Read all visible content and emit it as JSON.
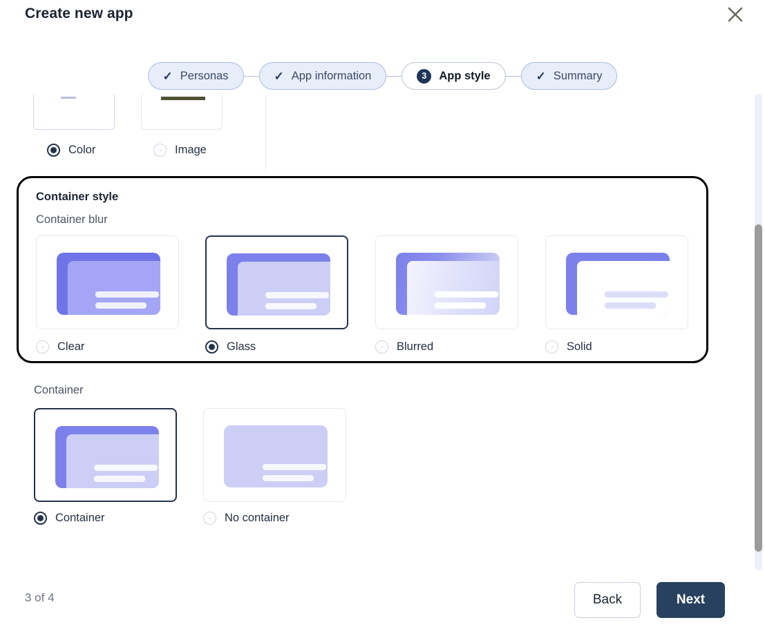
{
  "header": {
    "title": "Create new app",
    "close_icon": "close-icon"
  },
  "stepper": {
    "steps": [
      {
        "label": "Personas",
        "state": "done",
        "marker": "✓"
      },
      {
        "label": "App information",
        "state": "done",
        "marker": "✓"
      },
      {
        "label": "App style",
        "state": "active",
        "marker": "3"
      },
      {
        "label": "Summary",
        "state": "done",
        "marker": "✓"
      }
    ]
  },
  "background_type": {
    "options": [
      {
        "label": "Color",
        "selected": true
      },
      {
        "label": "Image",
        "selected": false
      }
    ]
  },
  "container_style": {
    "group_title": "Container style",
    "blur_label": "Container blur",
    "blur_options": [
      {
        "label": "Clear",
        "selected": false,
        "variant": "v-clear"
      },
      {
        "label": "Glass",
        "selected": true,
        "variant": "v-glass"
      },
      {
        "label": "Blurred",
        "selected": false,
        "variant": "v-blurred"
      },
      {
        "label": "Solid",
        "selected": false,
        "variant": "v-solid"
      }
    ],
    "container_label": "Container",
    "container_options": [
      {
        "label": "Container",
        "selected": true,
        "variant": "v-container"
      },
      {
        "label": "No container",
        "selected": false,
        "variant": "v-nocontainer"
      }
    ]
  },
  "footer": {
    "page_indicator": "3 of 4",
    "back_label": "Back",
    "next_label": "Next"
  },
  "colors": {
    "accent_navy": "#28415e",
    "step_done_bg": "#e8edfa",
    "step_done_border": "#a8bbe6",
    "thumb_blue": "#7b80ea",
    "thumb_light": "#cdcef6",
    "highlight_outline": "#000000",
    "scrollbar_thumb": "#9b9b9b"
  }
}
